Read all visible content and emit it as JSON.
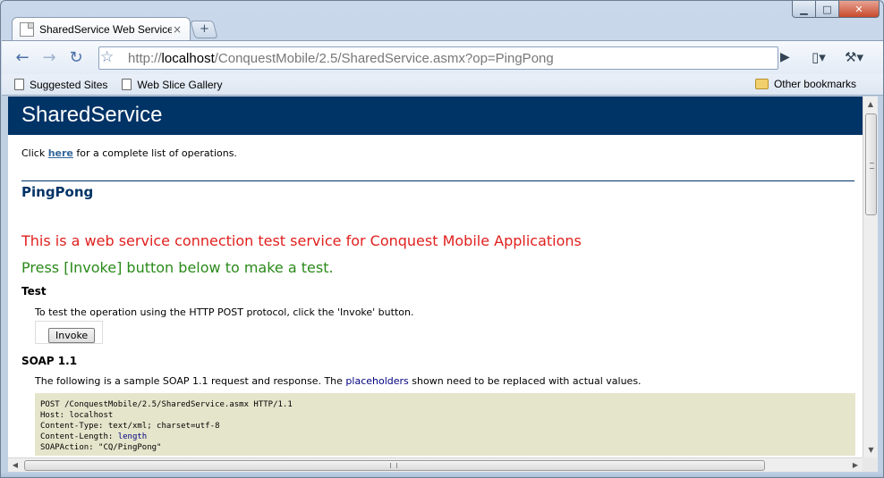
{
  "tab": {
    "title": "SharedService Web Service",
    "close": "×"
  },
  "newtab": "+",
  "window_controls": {
    "minimize": "▁",
    "maximize": "□",
    "close": "✕"
  },
  "toolbar": {
    "back": "←",
    "forward": "→",
    "reload": "↻",
    "bookmark_star": "☆",
    "url_scheme": "http://",
    "url_host": "localhost",
    "url_path": "/ConquestMobile/2.5/SharedService.asmx?op=PingPong",
    "go": "▶",
    "page_menu": "▯▾",
    "wrench_menu": "⚒▾"
  },
  "bookmarks": {
    "items": [
      {
        "label": "Suggested Sites"
      },
      {
        "label": "Web Slice Gallery"
      }
    ],
    "other": "Other bookmarks"
  },
  "page": {
    "service_name": "SharedService",
    "intro_prefix": "Click ",
    "intro_link": "here",
    "intro_suffix": " for a complete list of operations.",
    "operation": "PingPong",
    "description_red": "This is a web service connection test service for Conquest Mobile Applications",
    "description_green": "Press [Invoke] button below to make a test.",
    "test_heading": "Test",
    "test_text": "To test the operation using the HTTP POST protocol, click the 'Invoke' button.",
    "invoke_label": "Invoke",
    "soap_heading": "SOAP 1.1",
    "soap_text_prefix": "The following is a sample SOAP 1.1 request and response. The ",
    "soap_text_link": "placeholders",
    "soap_text_suffix": " shown need to be replaced with actual values.",
    "code": {
      "line1": "POST /ConquestMobile/2.5/SharedService.asmx HTTP/1.1",
      "line2": "Host: localhost",
      "line3": "Content-Type: text/xml; charset=utf-8",
      "line4_key": "Content-Length: ",
      "line4_val": "length",
      "line5": "SOAPAction: \"CQ/PingPong\""
    }
  },
  "colors": {
    "header_band": "#003366",
    "description_red": "#e0201e",
    "description_green": "#2a8a1a",
    "code_background": "#e5e5cc"
  }
}
